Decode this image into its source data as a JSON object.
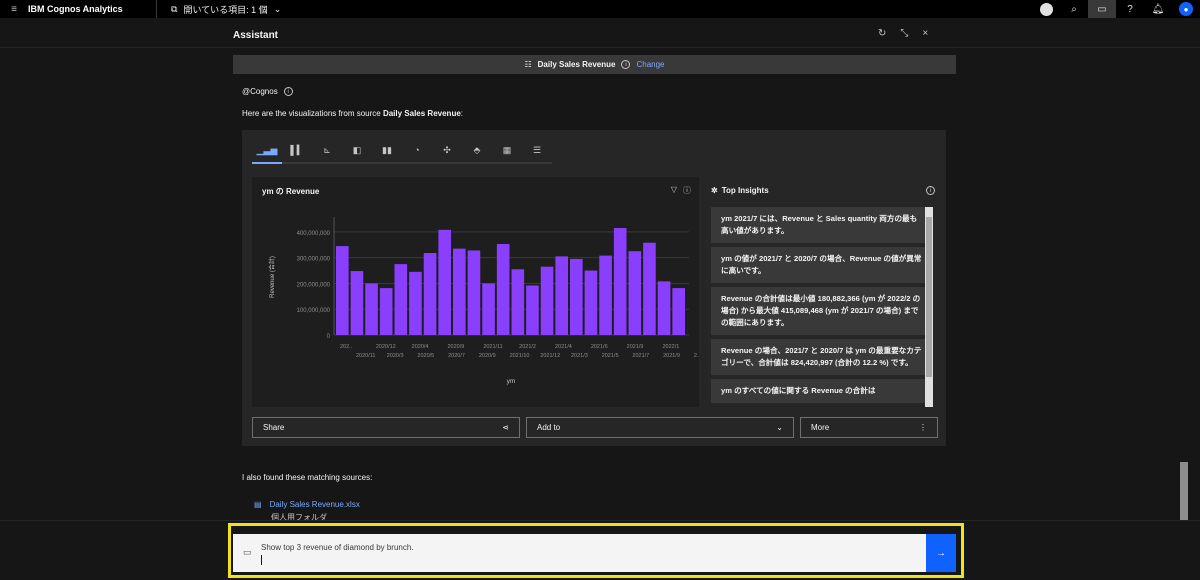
{
  "topbar": {
    "menu_icon": "hamburger-icon",
    "brand": "IBM Cognos Analytics",
    "open_items_label": "開いている項目: 1 個",
    "icons": [
      "globe-icon",
      "search-icon",
      "chat-icon",
      "help-icon",
      "notification-icon",
      "user-icon"
    ]
  },
  "assistant": {
    "title": "Assistant",
    "controls": [
      "↻",
      "⤡",
      "×"
    ]
  },
  "source_bar": {
    "source_name": "Daily Sales Revenue",
    "change_label": "Change"
  },
  "message": {
    "from": "@Cognos",
    "intro_prefix": "Here are the visualizations from source ",
    "intro_source": "Daily Sales Revenue",
    "intro_suffix": ":"
  },
  "viz_tabs": [
    "bar",
    "column",
    "line",
    "pie",
    "stacked",
    "donut",
    "scatter",
    "treemap",
    "grid",
    "table"
  ],
  "chart": {
    "title": "ym の Revenue",
    "icons": [
      "filter-icon",
      "info-icon"
    ]
  },
  "chart_data": {
    "type": "bar",
    "title": "ym の Revenue",
    "xlabel": "ym",
    "ylabel": "Revenue (合計)",
    "ylim": [
      0,
      450000000
    ],
    "yticks": [
      "0",
      "100,000,000",
      "200,000,000",
      "300,000,000",
      "400,000,000"
    ],
    "color": "#8a3ffc",
    "grid": true,
    "categories": [
      "2020/10",
      "2020/11",
      "2020/12",
      "2021/1",
      "2021/2",
      "2021/3",
      "2021/4",
      "2021/5",
      "2021/6",
      "2021/7",
      "2021/8",
      "2021/9",
      "2021/10",
      "2021/11",
      "2021/12",
      "2022/1",
      "2022/2",
      "2022/3",
      "2022/4",
      "2022/5",
      "2022/6",
      "2022/7",
      "2022/8",
      "2022/9",
      "2022/10",
      "2022/11"
    ],
    "values": [
      345000000,
      248000000,
      200000000,
      182000000,
      275000000,
      245000000,
      318000000,
      408000000,
      335000000,
      328000000,
      200000000,
      353000000,
      255000000,
      192000000,
      265000000,
      305000000,
      295000000,
      250000000,
      308000000,
      415000000,
      325000000,
      358000000,
      208000000,
      182000000,
      0,
      0
    ],
    "xtick_row1": [
      "202..",
      "2020/12",
      "2020/4",
      "2020/9",
      "2021/11",
      "2021/2",
      "2021/4",
      "2021/6",
      "2021/9",
      "2022/1"
    ],
    "xtick_row2": [
      "2020/11",
      "2020/3",
      "2020/5",
      "2020/7",
      "2020/9",
      "2021/10",
      "2021/12",
      "2021/3",
      "2021/5",
      "2021/7",
      "2021/9",
      "2.."
    ]
  },
  "insights": {
    "title": "Top Insights",
    "items": [
      "ym 2021/7 には、Revenue と Sales quantity 両方の最も高い値があります。",
      "ym の値が 2021/7 と 2020/7 の場合、Revenue の値が異常に高いです。",
      "Revenue の合計値は最小値 180,882,366 (ym が 2022/2 の場合) から最大値 415,089,468 (ym が 2021/7 の場合) までの範囲にあります。",
      "Revenue の場合、2021/7 と 2020/7 は ym の最重要なカテゴリーで、合計値は 824,420,997 (合計の 12.2 %) です。",
      "ym のすべての値に関する Revenue の合計は"
    ]
  },
  "actions": {
    "share": "Share",
    "add_to": "Add to",
    "more": "More"
  },
  "also_found": "I also found these matching sources:",
  "match": {
    "file": "Daily Sales Revenue.xlsx",
    "folder": "個人用フォルダ"
  },
  "input": {
    "text": "Show top 3 revenue of diamond by brunch.",
    "send_icon": "arrow-right-icon"
  },
  "colors": {
    "highlight": "#f1e21a",
    "accent": "#0f62fe",
    "bar": "#8a3ffc"
  }
}
